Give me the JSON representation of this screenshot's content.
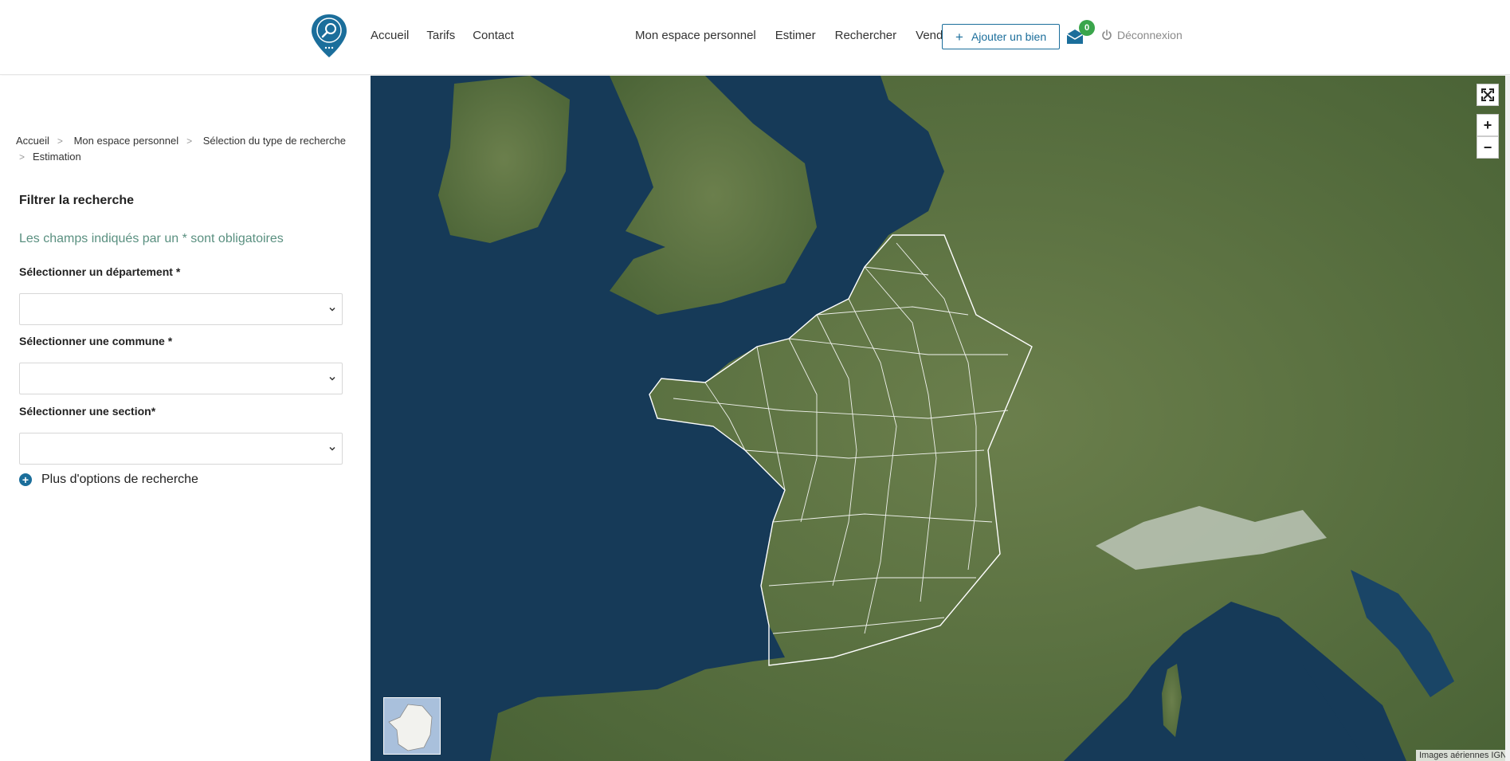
{
  "header": {
    "nav_left": [
      "Accueil",
      "Tarifs",
      "Contact"
    ],
    "nav_right": [
      "Mon espace personnel",
      "Estimer",
      "Rechercher",
      "Vendre"
    ],
    "add_button": "Ajouter un bien",
    "add_button_icon": "plus-icon",
    "mail_count": "0",
    "logout": "Déconnexion",
    "brand_color": "#1b6e9b",
    "badge_color": "#3aa54b"
  },
  "breadcrumb": [
    "Accueil",
    "Mon espace personnel",
    "Sélection du type de recherche",
    "Estimation"
  ],
  "filter": {
    "title": "Filtrer la recherche",
    "required_note": "Les champs indiqués par un * sont obligatoires",
    "department_label": "Sélectionner un département *",
    "department_value": "",
    "commune_label": "Sélectionner une commune *",
    "commune_value": "",
    "section_label": "Sélectionner une section*",
    "section_value": "",
    "more_options": "Plus d'options de recherche"
  },
  "map": {
    "attribution": "Images aériennes IGN",
    "controls": [
      "fullscreen-icon",
      "zoom-in-icon",
      "zoom-out-icon"
    ],
    "zoom_in_label": "+",
    "zoom_out_label": "−",
    "sea_color": "#163a58",
    "land_color": "#4f6b3a"
  }
}
